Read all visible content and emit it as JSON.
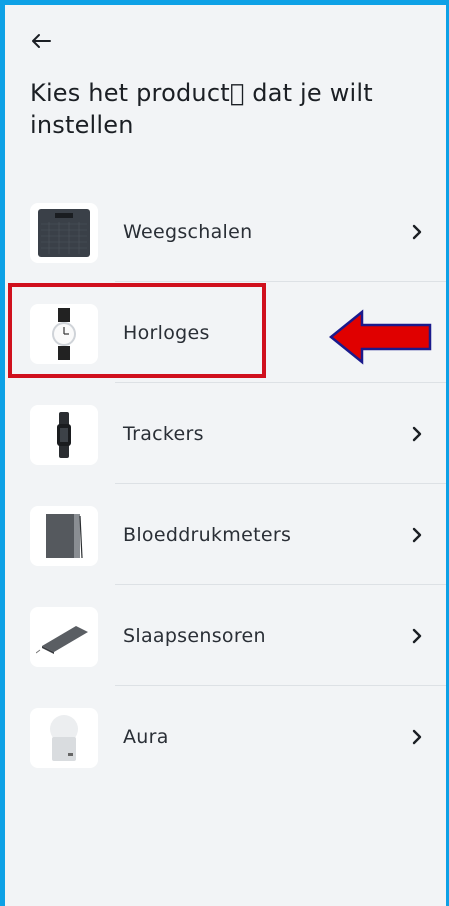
{
  "header": {
    "back_icon": "arrow-left-icon",
    "title": "Kies het product\u0000 dat je wilt instellen"
  },
  "products": [
    {
      "label": "Weegschalen",
      "icon": "scale-icon",
      "chevron": true
    },
    {
      "label": "Horloges",
      "icon": "watch-icon",
      "chevron": false
    },
    {
      "label": "Trackers",
      "icon": "tracker-icon",
      "chevron": true
    },
    {
      "label": "Bloeddrukmeters",
      "icon": "blood-pressure-monitor-icon",
      "chevron": true
    },
    {
      "label": "Slaapsensoren",
      "icon": "sleep-sensor-icon",
      "chevron": true
    },
    {
      "label": "Aura",
      "icon": "aura-device-icon",
      "chevron": true
    }
  ],
  "annotation": {
    "highlight_color": "#d0101d",
    "arrow_color": "#e00000",
    "arrow_outline": "#1a1a8c"
  }
}
